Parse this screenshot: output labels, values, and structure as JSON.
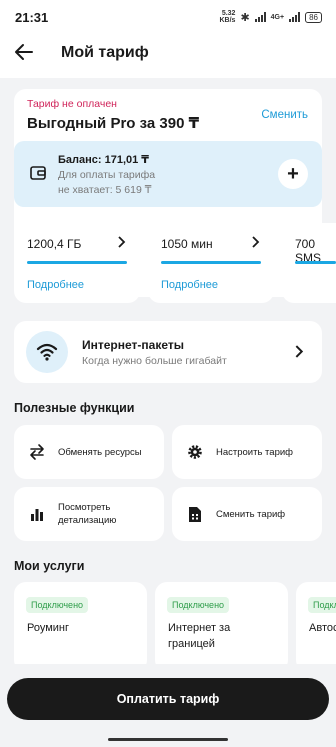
{
  "status_bar": {
    "time": "21:31",
    "speed_value": "5.32",
    "speed_unit": "KB/s",
    "network": "4G+",
    "battery": "86"
  },
  "header": {
    "title": "Мой тариф",
    "back_icon": "arrow-left-icon"
  },
  "plan": {
    "status": "Тариф не оплачен",
    "status_color": "#d0245a",
    "name": "Выгодный Pro за 390 ₸",
    "change_label": "Сменить",
    "balance": {
      "title": "Баланс: 171,01 ₸",
      "line1": "Для оплаты тарифа",
      "line2": "не хватает: 5 619 ₸",
      "add_icon": "plus-icon"
    }
  },
  "resources": [
    {
      "value": "1200,4 ГБ",
      "more": "Подробнее",
      "fill": 1.0
    },
    {
      "value": "1050 мин",
      "more": "Подробнее",
      "fill": 1.0
    },
    {
      "value": "700 SMS",
      "more": "",
      "fill": 1.0
    }
  ],
  "internet_packages": {
    "title": "Интернет-пакеты",
    "subtitle": "Когда нужно больше гигабайт",
    "icon": "wifi-icon"
  },
  "useful": {
    "title": "Полезные функции",
    "items": [
      {
        "label": "Обменять ресурсы",
        "icon": "swap-arrows-icon"
      },
      {
        "label": "Настроить тариф",
        "icon": "gear-icon"
      },
      {
        "label": "Посмотреть\nдетализацию",
        "icon": "bar-chart-icon"
      },
      {
        "label": "Сменить тариф",
        "icon": "sim-card-icon"
      }
    ]
  },
  "services": {
    "title": "Мои услуги",
    "items": [
      {
        "badge": "Подключено",
        "label": "Роуминг"
      },
      {
        "badge": "Подключено",
        "label": "Интернет за\nграницей"
      },
      {
        "badge": "Подкл",
        "label": "Автос"
      }
    ]
  },
  "pay_button": "Оплатить тариф",
  "colors": {
    "accent": "#1e9bd7",
    "progress": "#1ba7e3",
    "connected_text": "#2e9d4a",
    "connected_bg": "#e3f6e7",
    "balance_bg": "#dff0fa",
    "button_bg": "#1a1a1a"
  }
}
